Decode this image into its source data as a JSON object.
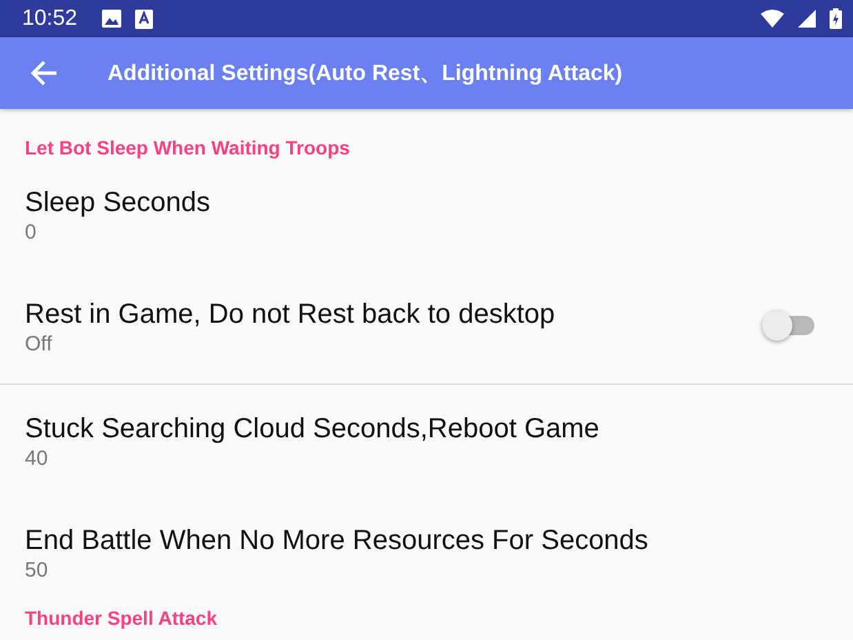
{
  "status_bar": {
    "time": "10:52"
  },
  "toolbar": {
    "title": "Additional Settings(Auto Rest、Lightning Attack)"
  },
  "items": [
    {
      "kind": "category",
      "title": "Let Bot Sleep When Waiting Troops"
    },
    {
      "kind": "preference",
      "title": "Sleep Seconds",
      "summary": "0"
    },
    {
      "kind": "switch",
      "title": "Rest in Game, Do not Rest back to desktop",
      "summary": "Off",
      "on": false
    },
    {
      "kind": "divider"
    },
    {
      "kind": "preference",
      "title": "Stuck Searching Cloud Seconds,Reboot Game",
      "summary": "40"
    },
    {
      "kind": "preference",
      "title": "End Battle When No More Resources For Seconds",
      "summary": "50"
    },
    {
      "kind": "category",
      "title": "Thunder Spell Attack"
    }
  ]
}
